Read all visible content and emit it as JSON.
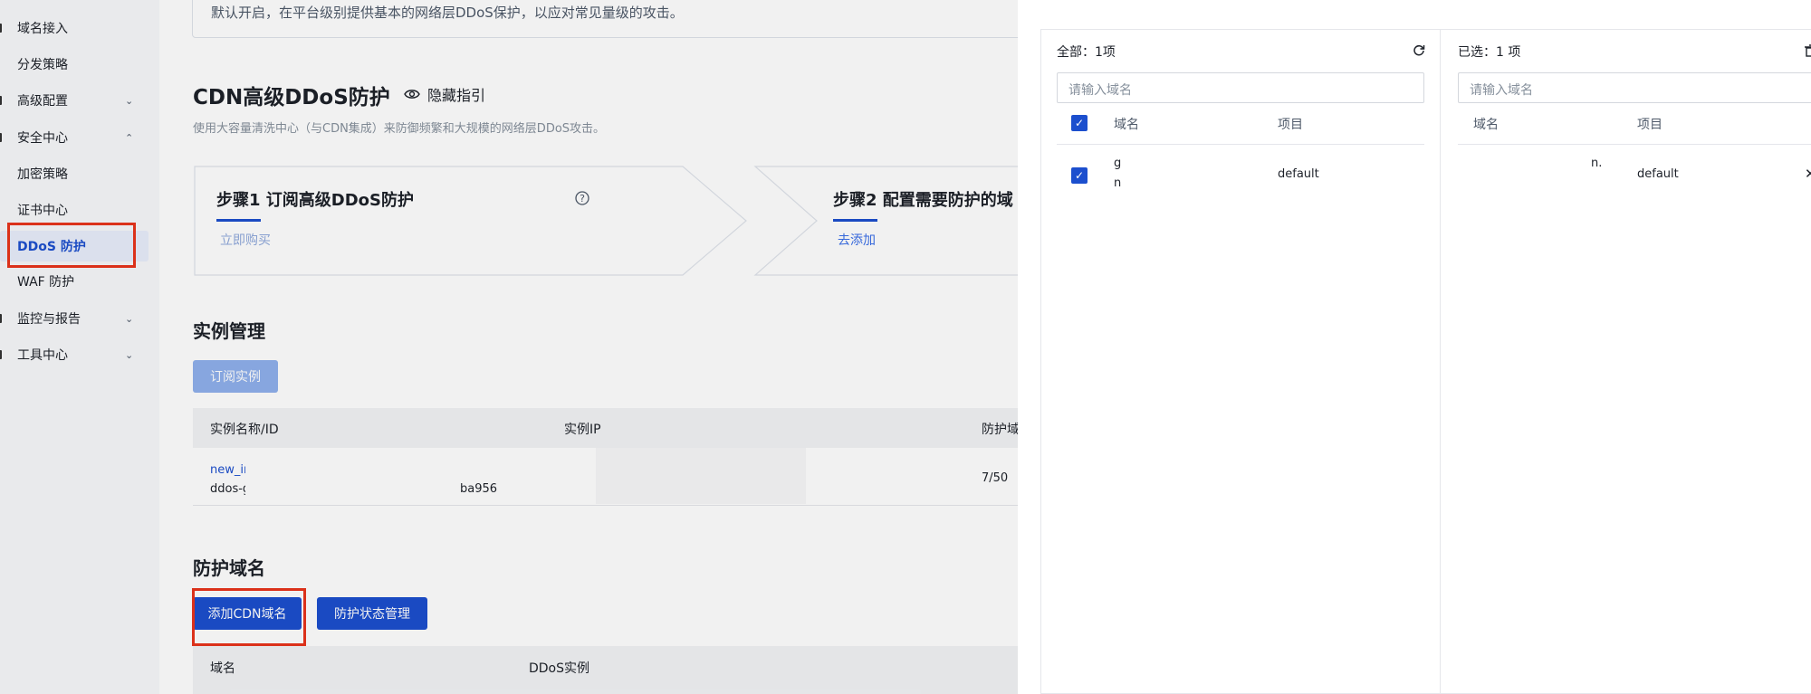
{
  "sidebar": {
    "items": [
      {
        "label": "域名接入",
        "chevron": ""
      },
      {
        "label": "分发策略",
        "chevron": ""
      },
      {
        "label": "高级配置",
        "chevron": "⌄"
      },
      {
        "label": "安全中心",
        "chevron": "⌃"
      },
      {
        "label": "加密策略",
        "chevron": ""
      },
      {
        "label": "证书中心",
        "chevron": ""
      },
      {
        "label": "DDoS 防护",
        "chevron": ""
      },
      {
        "label": "WAF 防护",
        "chevron": ""
      },
      {
        "label": "监控与报告",
        "chevron": "⌄"
      },
      {
        "label": "工具中心",
        "chevron": "⌄"
      }
    ]
  },
  "main": {
    "notice": "默认开启，在平台级别提供基本的网络层DDoS保护，以应对常见量级的攻击。",
    "title": "CDN高级DDoS防护",
    "hide_guide": "隐藏指引",
    "description": "使用大容量清洗中心（与CDN集成）来防御频繁和大规模的网络层DDoS攻击。",
    "step1": {
      "title": "步骤1 订阅高级DDoS防护",
      "link": "立即购买"
    },
    "step2": {
      "title": "步骤2 配置需要防护的域",
      "link": "去添加"
    },
    "instances": {
      "heading": "实例管理",
      "subscribe_button": "订阅实例",
      "columns": [
        "实例名称/ID",
        "实例IP",
        "防护域"
      ],
      "row": {
        "name": "new_ins",
        "id_prefix": "ddos-glc",
        "id_suffix": "ba956",
        "count": "7/50"
      }
    },
    "domains": {
      "heading": "防护域名",
      "add_button": "添加CDN域名",
      "status_button": "防护状态管理",
      "columns": [
        "域名",
        "DDoS实例"
      ]
    }
  },
  "drawer": {
    "left": {
      "header": "全部：1项",
      "search_placeholder": "请输入域名",
      "columns": [
        "域名",
        "项目"
      ],
      "row": {
        "domain_line1": "g",
        "domain_line2": "n",
        "project": "default"
      }
    },
    "right": {
      "header": "已选：1 项",
      "search_placeholder": "请输入域名",
      "columns": [
        "域名",
        "项目"
      ],
      "row": {
        "domain": "n.",
        "project": "default"
      }
    }
  },
  "colors": {
    "primary": "#1c4fce",
    "highlight": "#e8341c",
    "link": "#3a6fe8"
  }
}
